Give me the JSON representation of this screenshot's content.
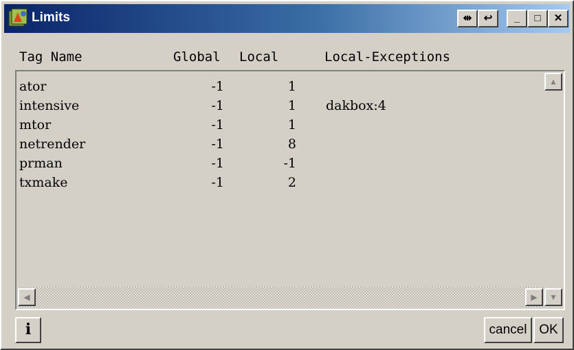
{
  "window": {
    "title": "Limits",
    "controls": {
      "pin": "⇹",
      "restore": "↩",
      "minimize": "_",
      "maximize": "□",
      "close": "✕"
    }
  },
  "table": {
    "headers": {
      "tag_name": "Tag Name",
      "global": "Global",
      "local": "Local",
      "exceptions": "Local-Exceptions"
    },
    "rows": [
      {
        "tag": "ator",
        "global": "-1",
        "local": "1",
        "exceptions": ""
      },
      {
        "tag": "intensive",
        "global": "-1",
        "local": "1",
        "exceptions": "dakbox:4"
      },
      {
        "tag": "mtor",
        "global": "-1",
        "local": "1",
        "exceptions": ""
      },
      {
        "tag": "netrender",
        "global": "-1",
        "local": "8",
        "exceptions": ""
      },
      {
        "tag": "prman",
        "global": "-1",
        "local": "-1",
        "exceptions": ""
      },
      {
        "tag": "txmake",
        "global": "-1",
        "local": "2",
        "exceptions": ""
      }
    ]
  },
  "footer": {
    "info_label": "i",
    "cancel_label": "cancel",
    "ok_label": "OK"
  }
}
